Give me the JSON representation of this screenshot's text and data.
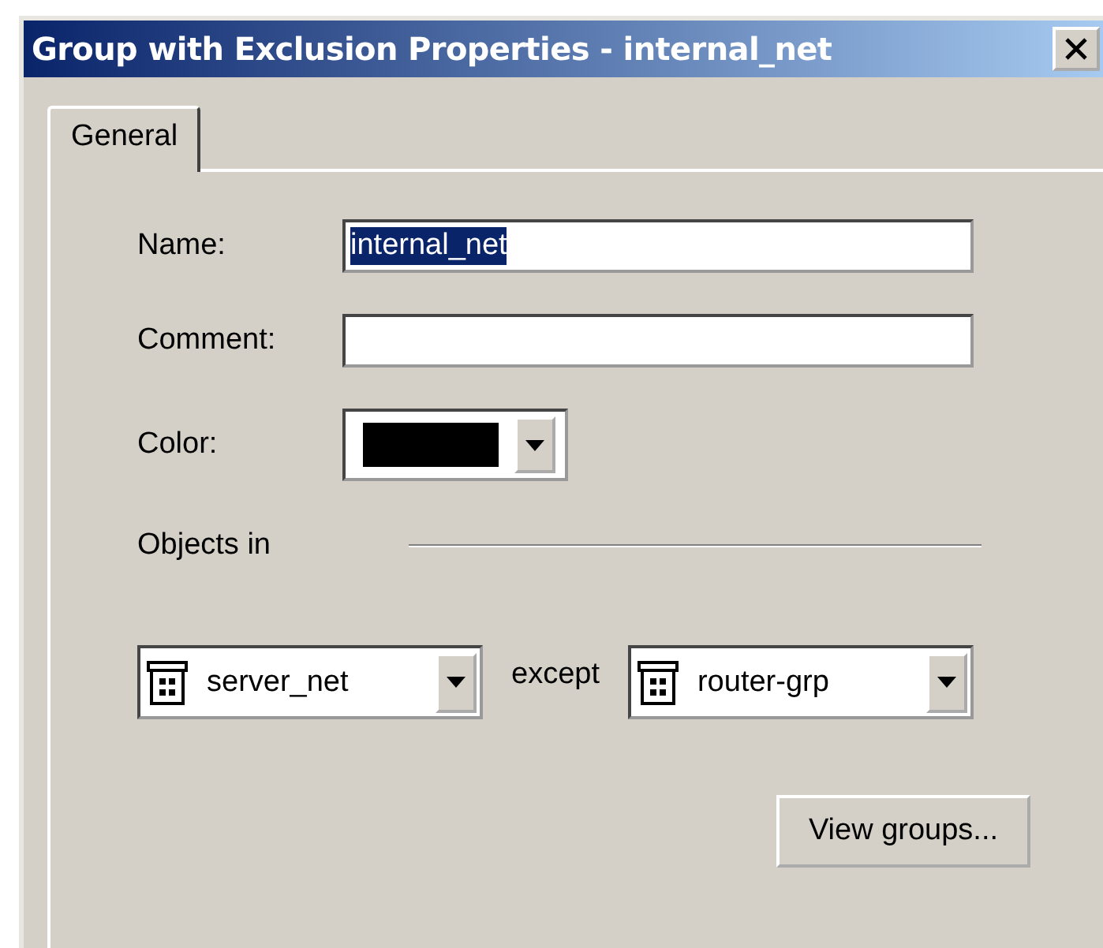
{
  "window": {
    "title": "Group with Exclusion Properties - internal_net"
  },
  "tabs": [
    {
      "label": "General",
      "selected": true
    }
  ],
  "fields": [
    {
      "label": "Name:",
      "value": "internal_net",
      "text_selected": true
    },
    {
      "label": "Comment:"
    }
  ],
  "color_field": {
    "label": "Color:",
    "color": "#000000"
  },
  "objects": {
    "label": "Objects in",
    "include": "server_net",
    "separator": "except",
    "exclude": "router-grp"
  },
  "buttons": [
    "View groups..."
  ]
}
